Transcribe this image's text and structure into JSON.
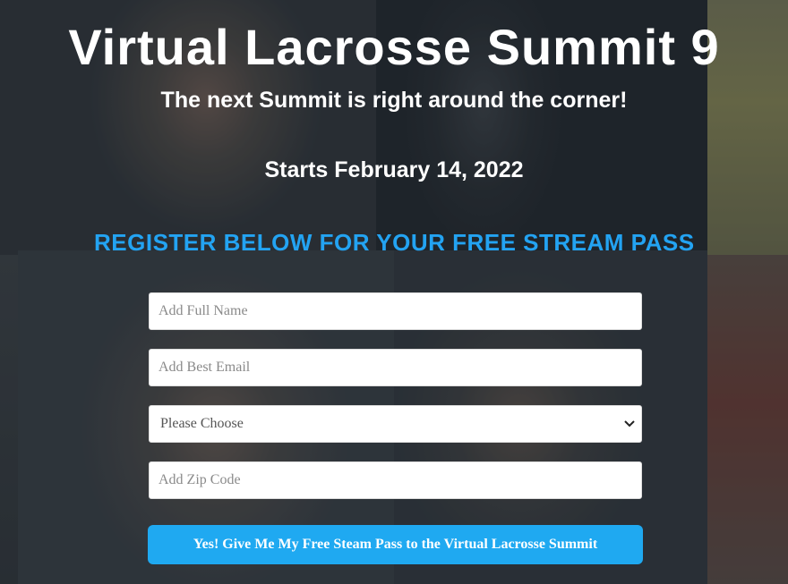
{
  "hero": {
    "title": "Virtual Lacrosse Summit 9",
    "subtitle": "The next Summit is right around the corner!",
    "start_date": "Starts February 14, 2022"
  },
  "form": {
    "heading": "REGISTER BELOW FOR YOUR FREE STREAM PASS",
    "full_name": {
      "placeholder": "Add Full Name",
      "value": ""
    },
    "email": {
      "placeholder": "Add Best Email",
      "value": ""
    },
    "choice": {
      "selected": "Please Choose"
    },
    "zip": {
      "placeholder": "Add Zip Code",
      "value": ""
    },
    "submit_label": "Yes! Give Me My Free Steam Pass to the Virtual Lacrosse Summit"
  },
  "colors": {
    "accent": "#1fa9f1",
    "heading_blue": "#23a3f2",
    "text_white": "#ffffff"
  },
  "icons": {
    "select_arrow": "chevron-down-icon"
  }
}
